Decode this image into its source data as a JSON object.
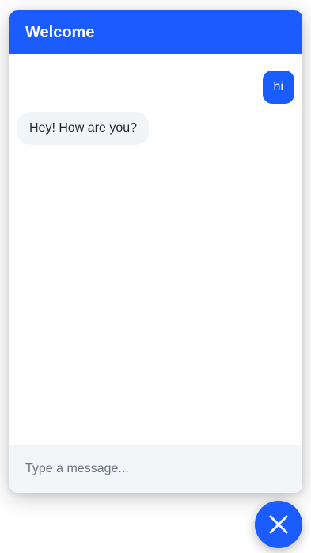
{
  "chat": {
    "title": "Welcome",
    "messages": [
      {
        "sender": "user",
        "text": "hi"
      },
      {
        "sender": "bot",
        "text": "Hey! How are you?"
      }
    ],
    "input": {
      "placeholder": "Type a message..."
    }
  },
  "fab": {
    "icon": "close-icon"
  },
  "colors": {
    "brand": "#1a5cff",
    "bot_bubble": "#f2f5f8",
    "input_background": "#f3f6f9",
    "text": "#1f2633",
    "placeholder": "#6b7280"
  }
}
